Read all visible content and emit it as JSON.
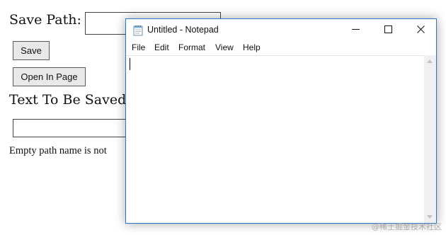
{
  "page": {
    "save_path_label": "Save Path:",
    "save_path_value": "",
    "save_button": "Save",
    "open_in_page_button": "Open In Page",
    "text_to_save_label": "Text To Be Saved:",
    "text_to_save_value": "",
    "status_message": "Empty path name is not"
  },
  "notepad": {
    "title": "Untitled - Notepad",
    "menu": [
      "File",
      "Edit",
      "Format",
      "View",
      "Help"
    ],
    "content": "",
    "icons": {
      "app": "notepad-icon",
      "minimize": "minimize-icon",
      "maximize": "maximize-icon",
      "close": "close-icon"
    }
  },
  "watermark": "@稀土掘金技术社区",
  "colors": {
    "window_border": "#2b78c9",
    "button_face": "#e9e9e9"
  }
}
